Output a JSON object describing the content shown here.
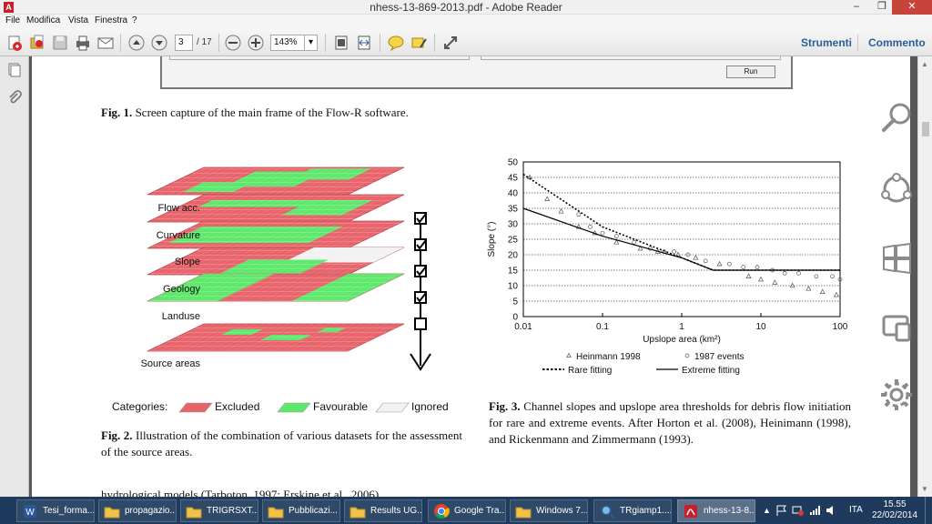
{
  "window": {
    "title": "nhess-13-869-2013.pdf - Adobe Reader",
    "app_icon": "adobe-reader-icon"
  },
  "menu": [
    "File",
    "Modifica",
    "Vista",
    "Finestra",
    "?"
  ],
  "toolbar": {
    "page_current": "3",
    "page_total": "/ 17",
    "zoom": "143%",
    "tools_label": "Strumenti",
    "comment_label": "Commento"
  },
  "document": {
    "run_button": "Run",
    "fig1_label": "Fig. 1.",
    "fig1_caption": "Screen capture of the main frame of the Flow-R software.",
    "fig2_label": "Fig. 2.",
    "fig2_caption": "Illustration of the combination of various datasets for the assessment of the source areas.",
    "fig3_label": "Fig. 3.",
    "fig3_caption": "Channel slopes and upslope area thresholds for debris flow initiation for rare and extreme events. After Horton et al. (2008), Heinimann (1998), and Rickenmann and Zimmermann (1993).",
    "body_text_fragment": "hydrological models (Tarboton, 1997; Erskine et al., 2006)"
  },
  "layers_figure": {
    "layers": [
      "Flow acc.",
      "Curvature",
      "Slope",
      "Geology",
      "Landuse",
      "Source areas"
    ],
    "checks": [
      true,
      true,
      true,
      true,
      false
    ],
    "categories_label": "Categories:",
    "categories": [
      {
        "name": "Excluded",
        "color": "#e8646b"
      },
      {
        "name": "Favourable",
        "color": "#5de86b"
      },
      {
        "name": "Ignored",
        "color": "#f2f2f2"
      }
    ]
  },
  "chart_data": {
    "type": "scatter",
    "xlabel": "Upslope area (km²)",
    "ylabel": "Slope (°)",
    "xscale": "log",
    "xlim": [
      0.01,
      100
    ],
    "ylim": [
      0,
      50
    ],
    "xticks": [
      "0.01",
      "0.1",
      "1",
      "10",
      "100"
    ],
    "yticks": [
      "0",
      "5",
      "10",
      "15",
      "20",
      "25",
      "30",
      "35",
      "40",
      "45",
      "50"
    ],
    "grid": "horizontal dotted",
    "legend_placement": "bottom",
    "series": [
      {
        "name": "Heinmann 1998",
        "marker": "triangle",
        "points": [
          [
            0.012,
            45
          ],
          [
            0.02,
            38
          ],
          [
            0.03,
            34
          ],
          [
            0.05,
            29
          ],
          [
            0.08,
            27
          ],
          [
            0.15,
            24
          ],
          [
            0.3,
            22
          ],
          [
            0.5,
            21
          ],
          [
            0.9,
            20
          ],
          [
            1.5,
            19
          ],
          [
            3,
            17
          ],
          [
            7,
            13
          ],
          [
            10,
            12
          ],
          [
            15,
            11
          ],
          [
            25,
            10
          ],
          [
            40,
            9
          ],
          [
            60,
            8
          ],
          [
            90,
            7
          ]
        ]
      },
      {
        "name": "1987 events",
        "marker": "circle",
        "points": [
          [
            0.05,
            33
          ],
          [
            0.07,
            29
          ],
          [
            0.1,
            27
          ],
          [
            0.15,
            26
          ],
          [
            0.25,
            24
          ],
          [
            0.4,
            22
          ],
          [
            0.6,
            21
          ],
          [
            0.8,
            21
          ],
          [
            1.2,
            20
          ],
          [
            2,
            18
          ],
          [
            4,
            17
          ],
          [
            6,
            16
          ],
          [
            9,
            16
          ],
          [
            14,
            15
          ],
          [
            20,
            14
          ],
          [
            30,
            14
          ],
          [
            50,
            13
          ],
          [
            80,
            13
          ],
          [
            100,
            12
          ]
        ]
      },
      {
        "name": "Rare fitting",
        "style": "dotted",
        "points": [
          [
            0.01,
            46
          ],
          [
            0.1,
            29
          ],
          [
            1,
            19
          ],
          [
            2.5,
            15
          ],
          [
            100,
            15
          ]
        ]
      },
      {
        "name": "Extreme fitting",
        "style": "solid",
        "points": [
          [
            0.01,
            35
          ],
          [
            0.1,
            26
          ],
          [
            1,
            19
          ],
          [
            2.5,
            15
          ],
          [
            100,
            15
          ]
        ]
      }
    ]
  },
  "taskbar": {
    "tasks": [
      {
        "label": "Tesi_forma...",
        "icon": "word-icon"
      },
      {
        "label": "propagazio...",
        "icon": "folder-icon"
      },
      {
        "label": "TRIGRSXT...",
        "icon": "folder-icon"
      },
      {
        "label": "Pubblicazi...",
        "icon": "folder-icon"
      },
      {
        "label": "Results UG...",
        "icon": "folder-icon"
      },
      {
        "label": "Google Tra...",
        "icon": "chrome-icon"
      },
      {
        "label": "Windows 7...",
        "icon": "folder-icon"
      },
      {
        "label": "TRgiamp1....",
        "icon": "search-app-icon"
      },
      {
        "label": "nhess-13-8...",
        "icon": "adobe-reader-icon"
      }
    ],
    "lang": "ITA",
    "time": "15.55",
    "date": "22/02/2014"
  }
}
